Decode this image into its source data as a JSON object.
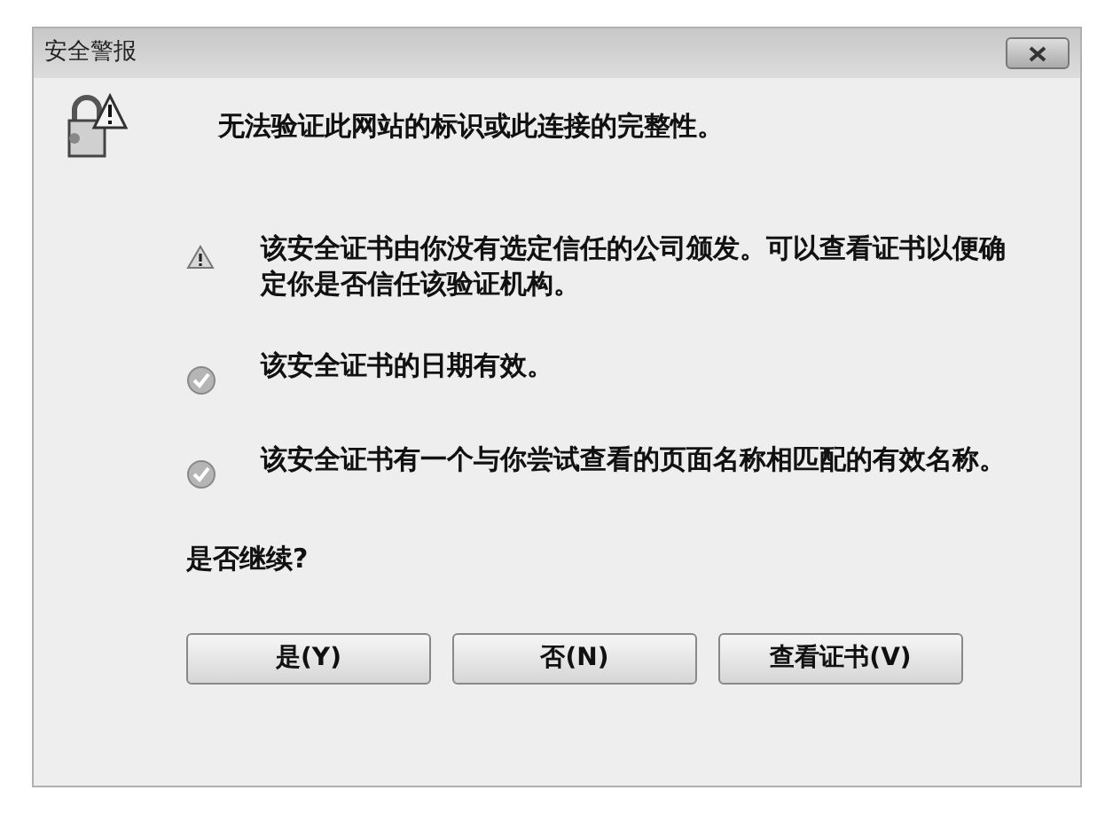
{
  "window": {
    "title": "安全警报"
  },
  "heading": "无法验证此网站的标识或此连接的完整性。",
  "items": [
    {
      "kind": "warning",
      "text": "该安全证书由你没有选定信任的公司颁发。可以查看证书以便确定你是否信任该验证机构。"
    },
    {
      "kind": "ok",
      "text": "该安全证书的日期有效。"
    },
    {
      "kind": "ok",
      "text": "该安全证书有一个与你尝试查看的页面名称相匹配的有效名称。"
    }
  ],
  "question": "是否继续?",
  "buttons": [
    "是(Y)",
    "否(N)",
    "查看证书(V)"
  ]
}
